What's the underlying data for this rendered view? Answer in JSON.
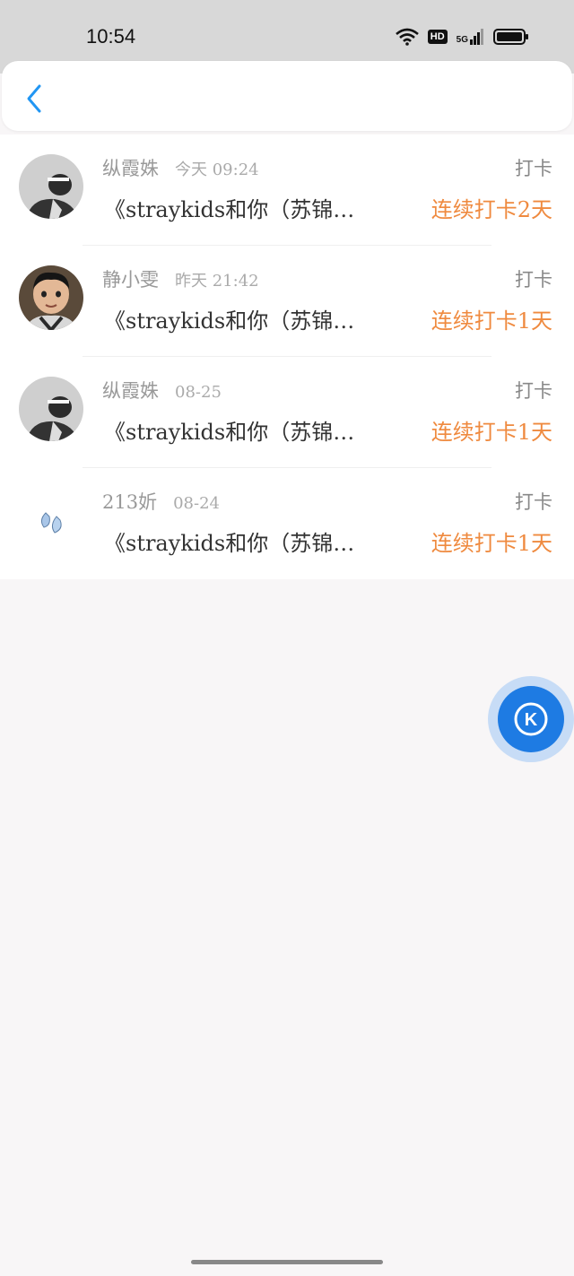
{
  "status_bar": {
    "time": "10:54",
    "hd": "HD",
    "network": "5G",
    "icons": [
      "wifi-icon",
      "hd-icon",
      "signal-5g-icon",
      "battery-icon"
    ]
  },
  "nav": {
    "back_icon": "chevron-left-icon",
    "accent": "#2196f3"
  },
  "records": [
    {
      "name": "纵霞姝",
      "time": "今天 09:24",
      "tag": "打卡",
      "title": "《straykids和你（苏锦…",
      "streak": "连续打卡2天",
      "avatar": "avatar-grayscale-person"
    },
    {
      "name": "静小雯",
      "time": "昨天 21:42",
      "tag": "打卡",
      "title": "《straykids和你（苏锦…",
      "streak": "连续打卡1天",
      "avatar": "avatar-child-photo"
    },
    {
      "name": "纵霞姝",
      "time": "08-25",
      "tag": "打卡",
      "title": "《straykids和你（苏锦…",
      "streak": "连续打卡1天",
      "avatar": "avatar-grayscale-person"
    },
    {
      "name": "213妡",
      "time": "08-24",
      "tag": "打卡",
      "title": "《straykids和你（苏锦…",
      "streak": "连续打卡1天",
      "avatar": "avatar-blue-drops"
    }
  ],
  "floating_button": {
    "icon": "k-logo-icon",
    "letter": "K",
    "color": "#1e7be3"
  },
  "colors": {
    "streak": "#ef8a3f",
    "background": "#f8f6f7"
  }
}
